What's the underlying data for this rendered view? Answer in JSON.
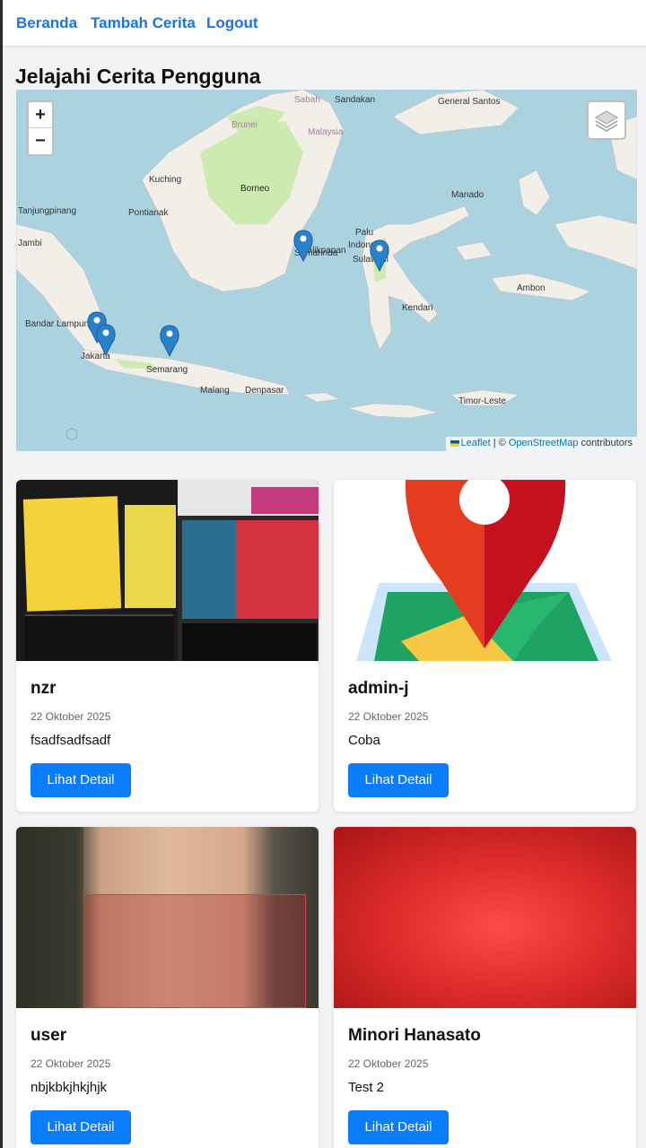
{
  "nav": {
    "links": [
      "Beranda",
      "Tambah Cerita",
      "Logout"
    ]
  },
  "page": {
    "title": "Jelajahi Cerita Pengguna"
  },
  "map": {
    "zoom_in": "+",
    "zoom_out": "−",
    "attribution": {
      "leaflet": "Leaflet",
      "separator": " | © ",
      "osm": "OpenStreetMap",
      "suffix": " contributors"
    },
    "labels": [
      "Sabah",
      "Sandakan",
      "General Santos",
      "Brunei",
      "Malaysia",
      "Kuching",
      "Borneo",
      "Pontianak",
      "Manado",
      "Samarinda",
      "Palu",
      "Ambon",
      "Kendari",
      "Bandar Lampung",
      "Jakarta",
      "Semarang",
      "Malang",
      "Denpasar",
      "Timor-Leste",
      "Jambi",
      "Tanjungpinang",
      "Balikpapan",
      "Sulawesi",
      "Indonesia"
    ],
    "colors": {
      "sea": "#aad3df",
      "land": "#f2efe9",
      "forest": "#cdebb0",
      "pin": "#2a81cb"
    }
  },
  "stories": [
    {
      "name": "nzr",
      "date": "22 Oktober 2025",
      "description": "fsadfsadfsadf",
      "button": "Lihat Detail",
      "image": "books-photo"
    },
    {
      "name": "admin-j",
      "date": "22 Oktober 2025",
      "description": "Coba",
      "button": "Lihat Detail",
      "image": "map-pin-illustration"
    },
    {
      "name": "user",
      "date": "22 Oktober 2025",
      "description": "nbjkbkjhkjhjk",
      "button": "Lihat Detail",
      "image": "wrist-photo"
    },
    {
      "name": "Minori Hanasato",
      "date": "22 Oktober 2025",
      "description": "Test 2",
      "button": "Lihat Detail",
      "image": "red-photo"
    }
  ]
}
